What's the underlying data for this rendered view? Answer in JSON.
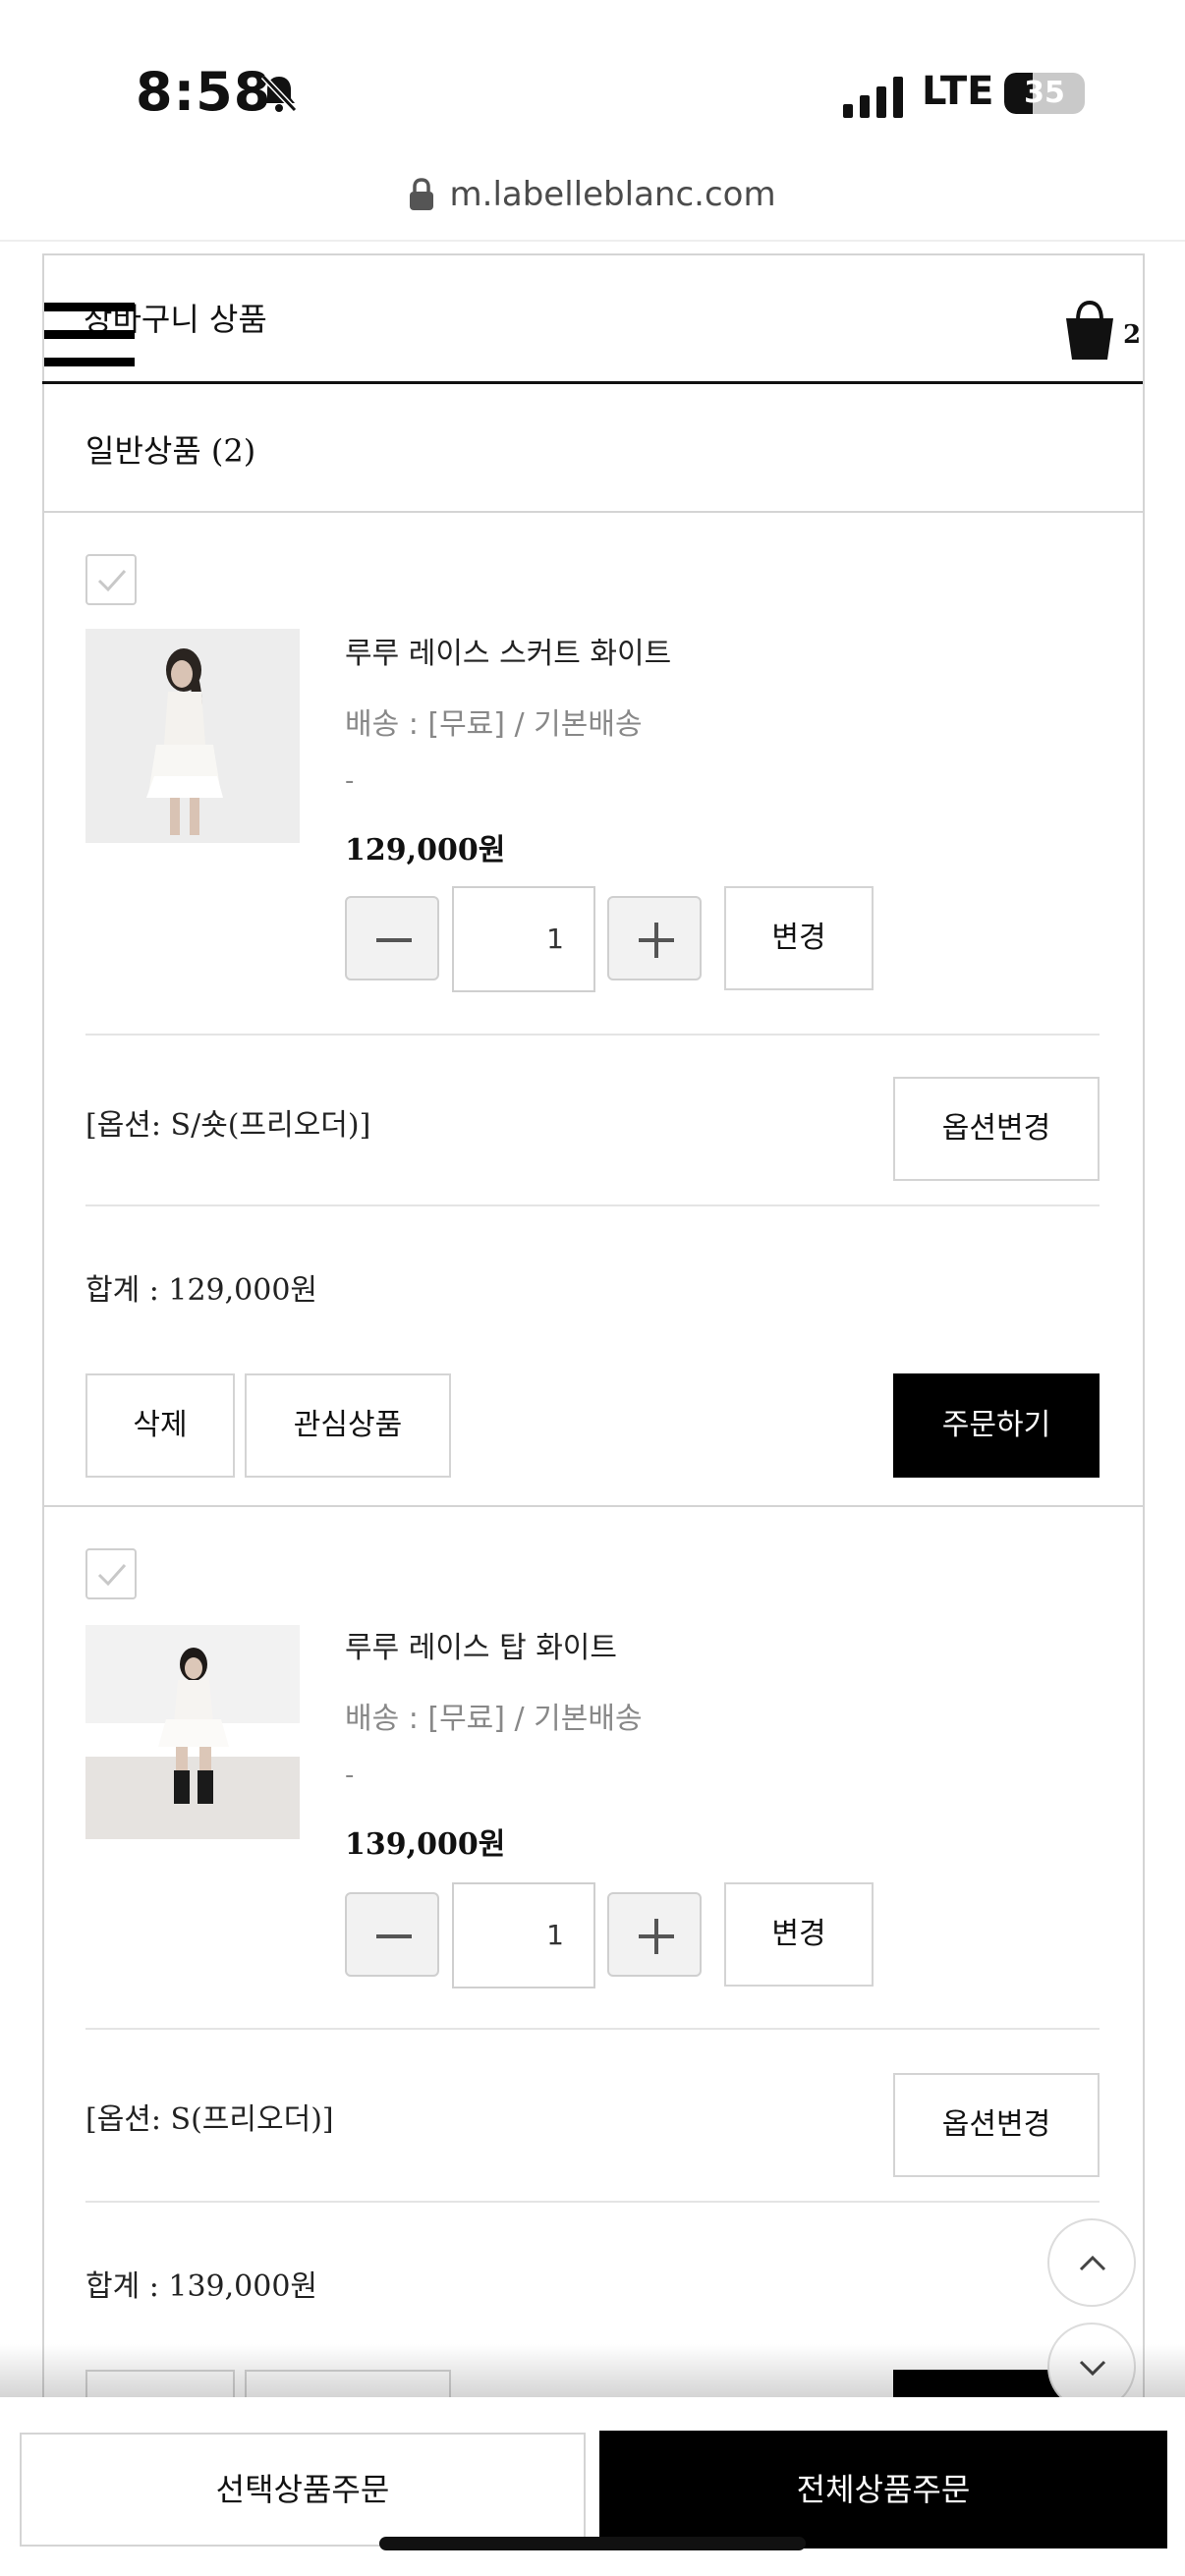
{
  "status_bar": {
    "time": "8:58",
    "network": "LTE",
    "battery_level": "35",
    "battery_fraction": 0.35
  },
  "browser": {
    "url": "m.labelleblanc.com"
  },
  "cart": {
    "title": "장바구니 상품",
    "bag_count": "2",
    "section_title": "일반상품 (2)"
  },
  "products": [
    {
      "name": "루루 레이스 스커트 화이트",
      "shipping": "배송 : [무료] / 기본배송",
      "dash": "-",
      "price": "129,000원",
      "quantity": "1",
      "change_label": "변경",
      "option": "[옵션: S/숏(프리오더)]",
      "option_change_label": "옵션변경",
      "total": "합계 : 129,000원",
      "delete_label": "삭제",
      "wishlist_label": "관심상품",
      "order_label": "주문하기"
    },
    {
      "name": "루루 레이스 탑 화이트",
      "shipping": "배송 : [무료] / 기본배송",
      "dash": "-",
      "price": "139,000원",
      "quantity": "1",
      "change_label": "변경",
      "option": "[옵션: S(프리오더)]",
      "option_change_label": "옵션변경",
      "total": "합계 : 139,000원"
    }
  ],
  "bottom_bar": {
    "order_selected_label": "선택상품주문",
    "order_all_label": "전체상품주문"
  },
  "icons": {
    "menu": "hamburger-menu-icon",
    "bag": "shopping-bag-icon",
    "checkbox": "checkmark-icon",
    "scroll_up": "chevron-up-icon",
    "scroll_down": "chevron-down-icon"
  }
}
